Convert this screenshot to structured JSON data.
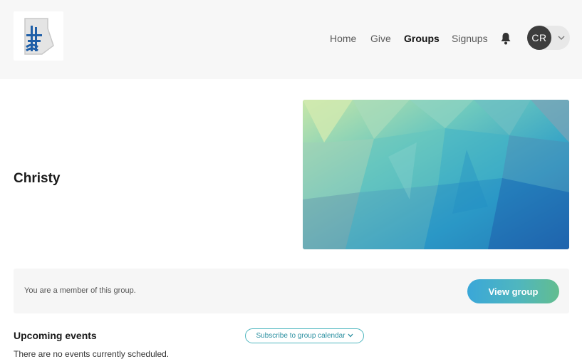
{
  "header": {
    "nav": [
      {
        "label": "Home",
        "active": false
      },
      {
        "label": "Give",
        "active": false
      },
      {
        "label": "Groups",
        "active": true
      },
      {
        "label": "Signups",
        "active": false
      }
    ],
    "notification_icon": "bell-icon",
    "user": {
      "initials": "CR",
      "menu_icon": "chevron-down-icon"
    },
    "logo_icon": "church-logo-icon"
  },
  "group": {
    "name": "Christy"
  },
  "membership": {
    "status_text": "You are a member of this group.",
    "view_button_label": "View group"
  },
  "events": {
    "title": "Upcoming events",
    "subscribe_label": "Subscribe to group calendar",
    "empty_text": "There are no events currently scheduled."
  },
  "colors": {
    "accent_start": "#3aa7d8",
    "accent_end": "#63bd8f",
    "header_bg": "#f7f7f7"
  }
}
